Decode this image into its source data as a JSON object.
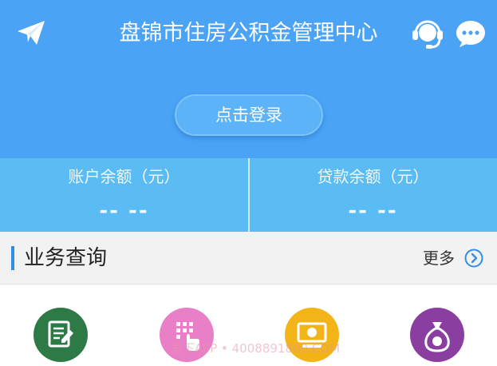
{
  "header": {
    "title": "盘锦市住房公积金管理中心",
    "icons": [
      "paper-plane-icon",
      "headset-icon",
      "chat-bubble-icon"
    ],
    "login_label": "点击登录"
  },
  "balances": [
    {
      "label": "账户余额（元）",
      "value": "-- --"
    },
    {
      "label": "贷款余额（元）",
      "value": "-- --"
    }
  ],
  "section": {
    "title": "业务查询",
    "more_label": "更多"
  },
  "services": [
    {
      "icon": "form-edit-icon",
      "color": "#2d7a47"
    },
    {
      "icon": "keypad-tap-icon",
      "color": "#e97fc7"
    },
    {
      "icon": "money-screen-icon",
      "color": "#f2b416"
    },
    {
      "icon": "money-bag-icon",
      "color": "#8a3fa0"
    }
  ],
  "watermark": "爱下APP • 4008891800.COM",
  "colors": {
    "header_blue": "#4aa3f5",
    "balance_blue": "#5bbcf4",
    "accent": "#2f8fe8"
  }
}
